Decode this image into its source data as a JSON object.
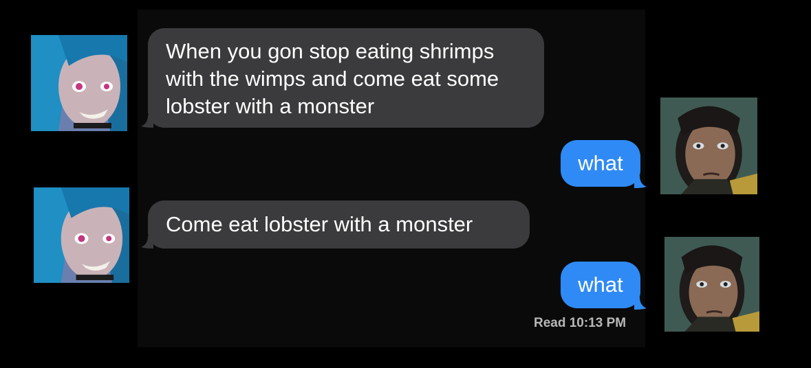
{
  "messages": [
    {
      "sender": "left",
      "text": "When you gon stop eating shrimps with the wimps and come eat some lobster with a monster"
    },
    {
      "sender": "right",
      "text": "what"
    },
    {
      "sender": "left",
      "text": "Come eat lobster with a monster"
    },
    {
      "sender": "right",
      "text": "what"
    }
  ],
  "receipt": {
    "status": "Read",
    "time": "10:13 PM",
    "label": "Read 10:13 PM"
  },
  "colors": {
    "incoming": "#3b3b3d",
    "outgoing": "#2f8af5",
    "background": "#000000"
  },
  "avatars": {
    "left": "blue-haired-character-icon",
    "right": "dark-haired-character-icon"
  }
}
